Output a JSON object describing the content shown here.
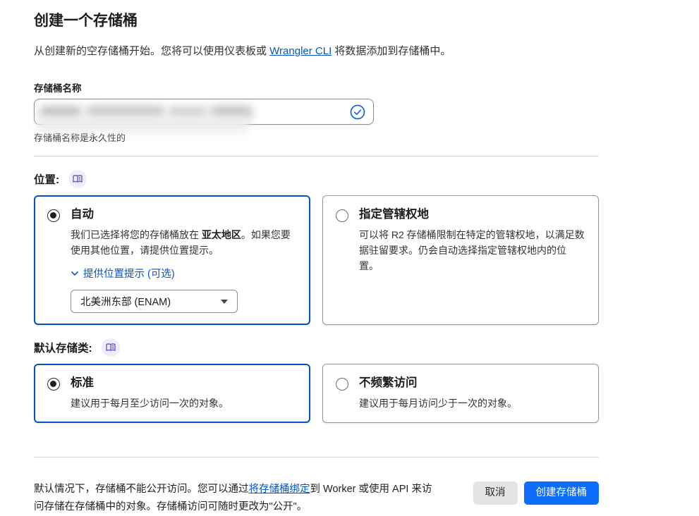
{
  "page": {
    "title": "创建一个存储桶",
    "intro_before_link": "从创建新的空存储桶开始。您将可以使用仪表板或 ",
    "intro_link": "Wrangler CLI",
    "intro_after_link": " 将数据添加到存储桶中。"
  },
  "bucket_name": {
    "label": "存储桶名称",
    "helper": "存储桶名称是永久性的",
    "value_state": "redacted",
    "valid_icon": "check-circle-icon"
  },
  "location": {
    "label": "位置:",
    "doc_icon": "open-book-icon",
    "options": [
      {
        "title": "自动",
        "desc_before": "我们已选择将您的存储桶放在 ",
        "desc_bold": "亚太地区",
        "desc_after": "。如果您要使用其他位置，请提供位置提示。",
        "hint_toggle": "提供位置提示 (可选)",
        "dropdown_value": "北美洲东部 (ENAM)",
        "selected": true
      },
      {
        "title": "指定管辖权地",
        "desc": "可以将 R2 存储桶限制在特定的管辖权地，以满足数据驻留要求。仍会自动选择指定管辖权地内的位置。",
        "selected": false
      }
    ]
  },
  "storage_class": {
    "label": "默认存储类:",
    "doc_icon": "open-book-icon",
    "options": [
      {
        "title": "标准",
        "desc": "建议用于每月至少访问一次的对象。",
        "selected": true
      },
      {
        "title": "不频繁访问",
        "desc": "建议用于每月访问少于一次的对象。",
        "selected": false
      }
    ]
  },
  "footer": {
    "text_before_link": "默认情况下，存储桶不能公开访问。您可以通过",
    "link": "将存储桶绑定",
    "text_after_link": "到 Worker 或使用 API 来访问存储在存储桶中的对象。存储桶访问可随时更改为\"公开\"。",
    "cancel_label": "取消",
    "create_label": "创建存储桶"
  },
  "colors": {
    "primary_button": "#0b6cfb",
    "link_blue": "#0756c9",
    "selected_card_border": "#0553be",
    "doc_icon_purple": "#5f54c7",
    "doc_icon_bg": "#efedfb",
    "valid_check_blue": "#1264e2"
  }
}
